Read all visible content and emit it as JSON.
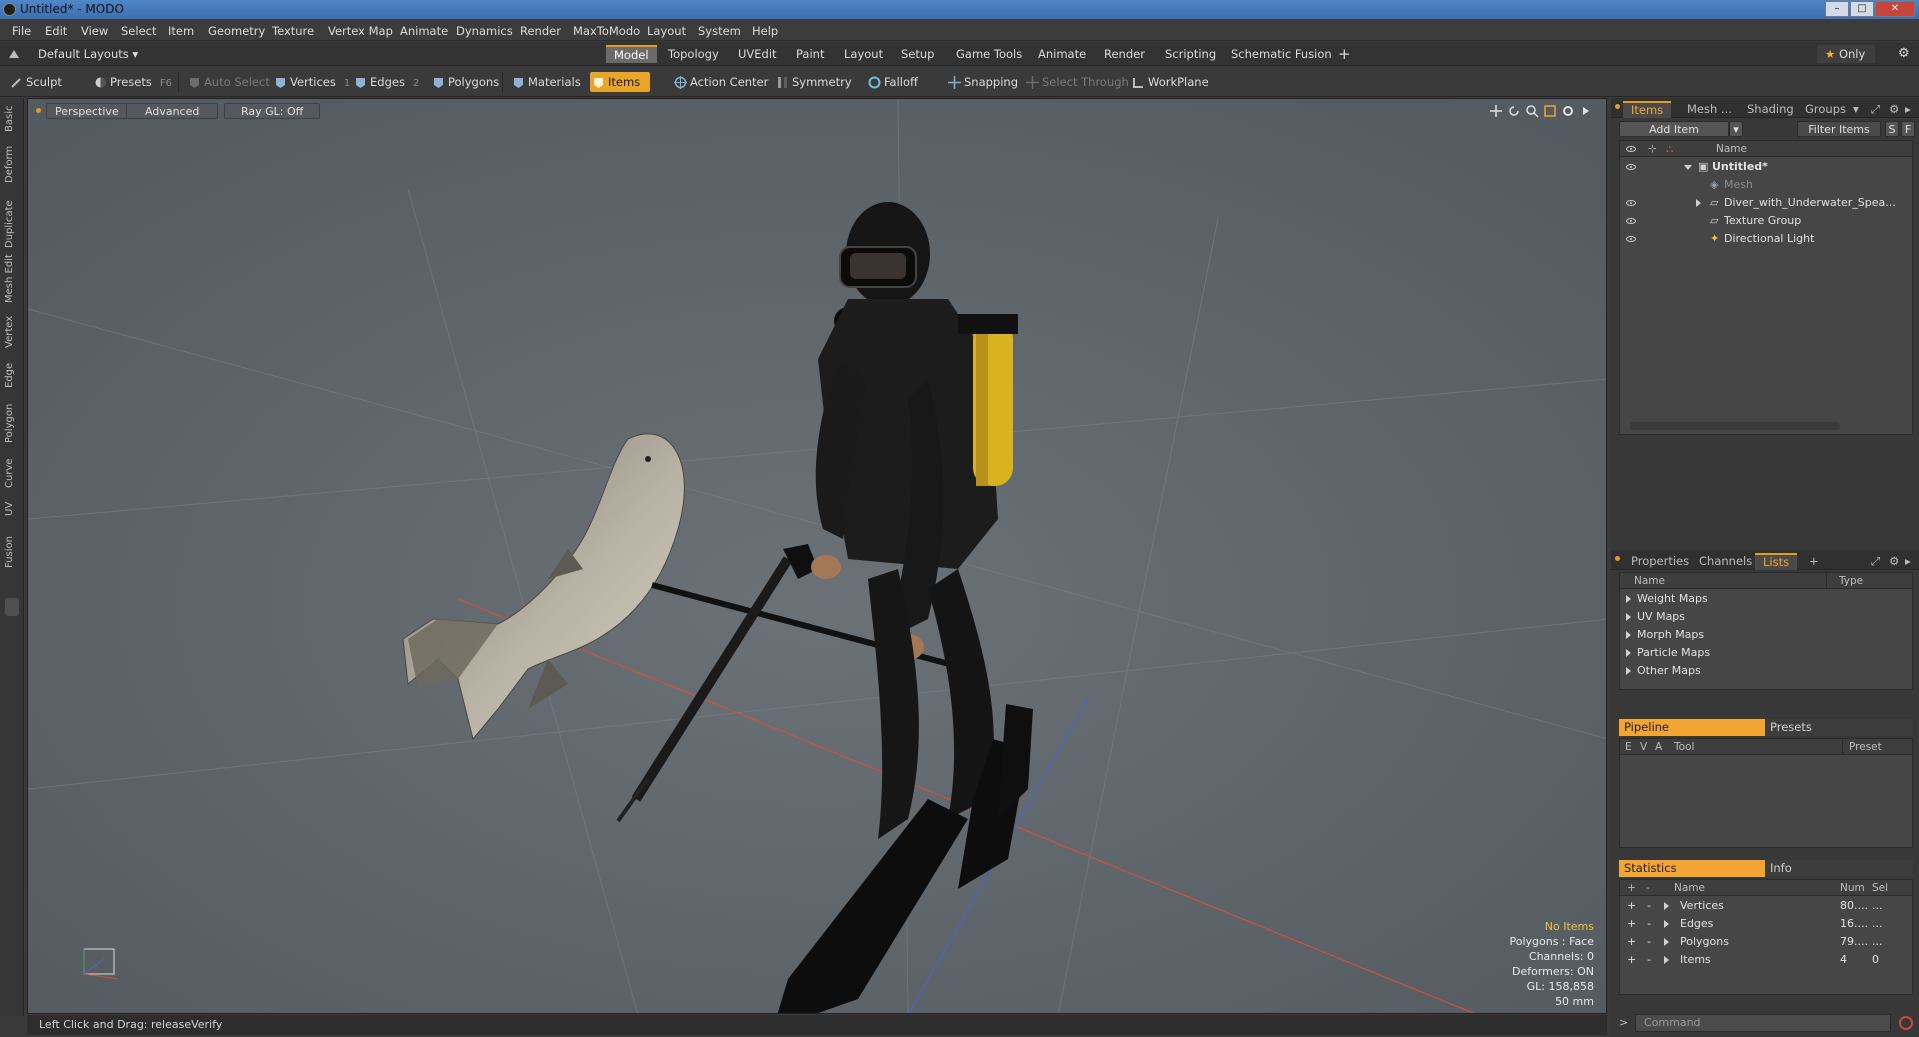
{
  "window": {
    "title": "Untitled* - MODO"
  },
  "menubar": [
    "File",
    "Edit",
    "View",
    "Select",
    "Item",
    "Geometry",
    "Texture",
    "Vertex Map",
    "Animate",
    "Dynamics",
    "Render",
    "MaxToModo",
    "Layout",
    "System",
    "Help"
  ],
  "layoutbar": {
    "layout_dropdown": "Default Layouts",
    "tabs": [
      "Model",
      "Topology",
      "UVEdit",
      "Paint",
      "Layout",
      "Setup",
      "Game Tools",
      "Animate",
      "Render",
      "Scripting",
      "Schematic Fusion"
    ],
    "active_tab": "Model",
    "add_tab": "+",
    "only_label": "Only"
  },
  "toolbar": {
    "sculpt": "Sculpt",
    "presets": "Presets",
    "presets_key": "F6",
    "auto_select": "Auto Select",
    "vertices": "Vertices",
    "vertices_key": "1",
    "edges": "Edges",
    "edges_key": "2",
    "polygons": "Polygons",
    "materials": "Materials",
    "items": "Items",
    "action_center": "Action Center",
    "symmetry": "Symmetry",
    "falloff": "Falloff",
    "snapping": "Snapping",
    "select_through": "Select Through",
    "workplane": "WorkPlane"
  },
  "left_strip": [
    "Basic",
    "Deform",
    "Duplicate",
    "Mesh Edit",
    "Vertex",
    "Edge",
    "Polygon",
    "Curve",
    "UV",
    "Fusion"
  ],
  "viewport": {
    "view_mode": "Perspective",
    "shading": "Advanced",
    "raygl": "Ray GL: Off",
    "info": {
      "no_items": "No Items",
      "polygons": "Polygons : Face",
      "channels": "Channels: 0",
      "deformers": "Deformers: ON",
      "gl": "GL: 158,858",
      "scale": "50 mm"
    }
  },
  "statusbar": {
    "text": "Left Click and Drag:   releaseVerify"
  },
  "items_panel": {
    "tabs": [
      "Items",
      "Mesh ...",
      "Shading",
      "Groups"
    ],
    "active_tab": "Items",
    "add_item": "Add Item",
    "filter": "Filter Items",
    "s_btn": "S",
    "f_btn": "F",
    "name_header": "Name",
    "tree": [
      {
        "label": "Untitled*",
        "level": 0,
        "expanded": true,
        "bold": true
      },
      {
        "label": "Mesh",
        "level": 1,
        "expanded": false,
        "dim": true
      },
      {
        "label": "Diver_with_Underwater_Spea...",
        "level": 1,
        "expanded": false
      },
      {
        "label": "Texture Group",
        "level": 1,
        "expanded": false
      },
      {
        "label": "Directional Light",
        "level": 1,
        "expanded": false
      }
    ]
  },
  "lists_panel": {
    "tabs": [
      "Properties",
      "Channels",
      "Lists"
    ],
    "active_tab": "Lists",
    "add": "+",
    "columns": [
      "Name",
      "Type"
    ],
    "rows": [
      "Weight Maps",
      "UV Maps",
      "Morph Maps",
      "Particle Maps",
      "Other Maps"
    ]
  },
  "pipeline_panel": {
    "tabs": [
      "Pipeline",
      "Presets"
    ],
    "columns": [
      "E",
      "V",
      "A",
      "Tool",
      "Preset"
    ]
  },
  "stats_panel": {
    "tabs": [
      "Statistics",
      "Info"
    ],
    "columns": [
      "+",
      "-",
      "Name",
      "Num",
      "Sel"
    ],
    "rows": [
      {
        "name": "Vertices",
        "num": "80....",
        "sel": "..."
      },
      {
        "name": "Edges",
        "num": "16....",
        "sel": "..."
      },
      {
        "name": "Polygons",
        "num": "79....",
        "sel": "..."
      },
      {
        "name": "Items",
        "num": "4",
        "sel": "0"
      }
    ]
  },
  "command": {
    "placeholder": "Command"
  },
  "colors": {
    "accent": "#e9a42b",
    "viewport_bg": "#5d656c",
    "panel": "#383838"
  }
}
